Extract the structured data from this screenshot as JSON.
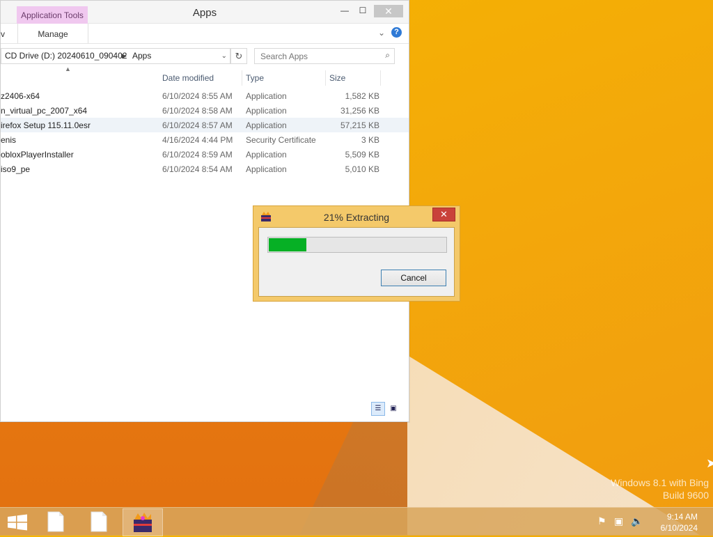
{
  "explorer": {
    "title": "Apps",
    "context_tab": "Application Tools",
    "ribbon_left_fragment": "v",
    "ribbon_tab": "Manage",
    "address": {
      "segment1": "CD Drive (D:) 20240610_090402",
      "segment2": "Apps"
    },
    "search_placeholder": "Search Apps",
    "columns": {
      "date": "Date modified",
      "type": "Type",
      "size": "Size"
    },
    "files": [
      {
        "name": "z2406-x64",
        "date": "6/10/2024 8:55 AM",
        "type": "Application",
        "size": "1,582 KB"
      },
      {
        "name": "n_virtual_pc_2007_x64",
        "date": "6/10/2024 8:58 AM",
        "type": "Application",
        "size": "31,256 KB"
      },
      {
        "name": "irefox Setup 115.11.0esr",
        "date": "6/10/2024 8:57 AM",
        "type": "Application",
        "size": "57,215 KB"
      },
      {
        "name": "enis",
        "date": "4/16/2024 4:44 PM",
        "type": "Security Certificate",
        "size": "3 KB"
      },
      {
        "name": "obloxPlayerInstaller",
        "date": "6/10/2024 8:59 AM",
        "type": "Application",
        "size": "5,509 KB"
      },
      {
        "name": "iso9_pe",
        "date": "6/10/2024 8:54 AM",
        "type": "Application",
        "size": "5,010 KB"
      }
    ],
    "selected_row_index": 2
  },
  "dialog": {
    "title": "21% Extracting",
    "progress_fraction": 0.21,
    "cancel_label": "Cancel",
    "progress_color": "#06b025"
  },
  "watermark": {
    "line1": "Windows 8.1 with Bing",
    "line2": "Build 9600"
  },
  "taskbar": {
    "time": "9:14 AM",
    "date": "6/10/2024",
    "items": [
      "file-icon",
      "file-icon",
      "archiver-app-icon"
    ]
  },
  "colors": {
    "accent_context_tab": "#f0c8ef",
    "dialog_frame": "#f4c96a",
    "close_red": "#c9423a"
  }
}
